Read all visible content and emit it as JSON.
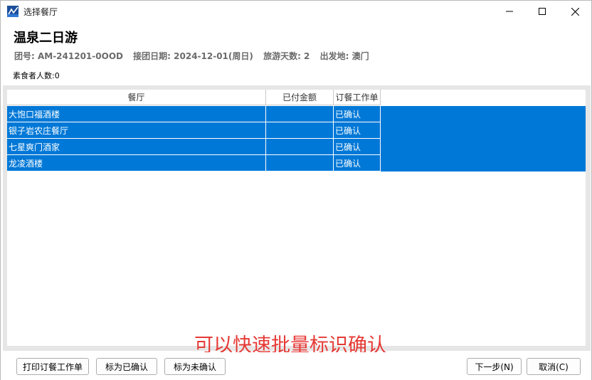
{
  "window": {
    "title": "选择餐厅"
  },
  "header": {
    "tour_title": "温泉二日游",
    "group_no": "团号: AM-241201-0OOD",
    "pickup_date": "接团日期: 2024-12-01(周日)",
    "days": "旅游天数: 2",
    "departure": "出发地: 澳门",
    "vegetarian_count": "素食者人数:0"
  },
  "grid": {
    "columns": [
      "餐厅",
      "已付金额",
      "订餐工作单"
    ],
    "rows": [
      {
        "name": "大饱口福酒楼",
        "paid": "",
        "order": "已确认"
      },
      {
        "name": "银子岩农庄餐厅",
        "paid": "",
        "order": "已确认"
      },
      {
        "name": "七星爽门酒家",
        "paid": "",
        "order": "已确认"
      },
      {
        "name": "龙凌酒楼",
        "paid": "",
        "order": "已确认"
      }
    ],
    "selection_color": "#0078d7"
  },
  "promo_text": "可以快速批量标识确认",
  "footer": {
    "print_label": "打印订餐工作单",
    "mark_confirmed_label": "标为已确认",
    "mark_unconfirmed_label": "标为未确认",
    "next_label": "下一步(N)",
    "cancel_label": "取消(C)"
  }
}
